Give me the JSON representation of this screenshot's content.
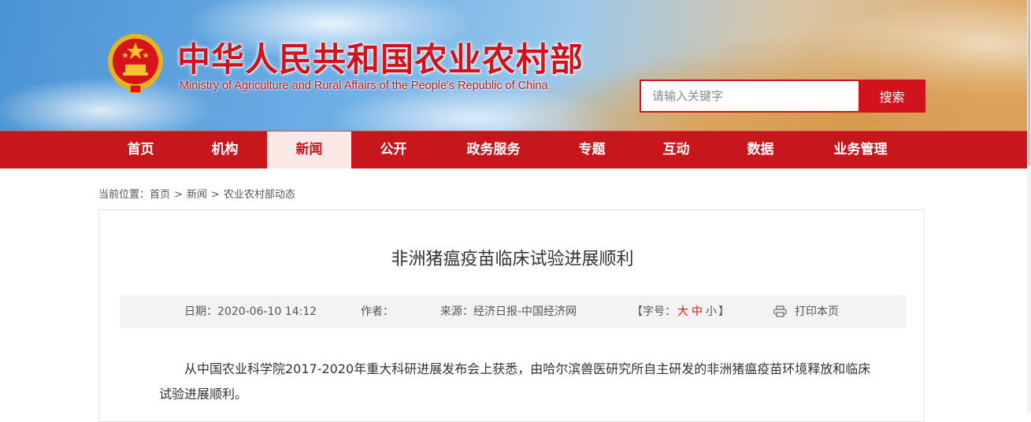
{
  "header": {
    "site_title": "中华人民共和国农业农村部",
    "site_subtitle": "Ministry of Agriculture and Rural Affairs of the People's Republic of China",
    "emblem_icon": "national-emblem-icon",
    "search": {
      "placeholder": "请输入关键字",
      "value": "",
      "button_label": "搜索"
    },
    "colors": {
      "brand_red": "#d0131c",
      "nav_red": "#c8161d",
      "active_tab_bg": "#fde8e8"
    }
  },
  "nav": {
    "items": [
      {
        "label": "首页",
        "active": false
      },
      {
        "label": "机构",
        "active": false
      },
      {
        "label": "新闻",
        "active": true
      },
      {
        "label": "公开",
        "active": false
      },
      {
        "label": "政务服务",
        "active": false
      },
      {
        "label": "专题",
        "active": false
      },
      {
        "label": "互动",
        "active": false
      },
      {
        "label": "数据",
        "active": false
      },
      {
        "label": "业务管理",
        "active": false
      }
    ]
  },
  "breadcrumb": {
    "prefix": "当前位置：",
    "items": [
      "首页",
      "新闻",
      "农业农村部动态"
    ],
    "separator": ">"
  },
  "article": {
    "title": "非洲猪瘟疫苗临床试验进展顺利",
    "meta": {
      "date_label": "日期：",
      "date_value": "2020-06-10 14:12",
      "author_label": "作者：",
      "author_value": "",
      "source_label": "来源：",
      "source_value": "经济日报-中国经济网",
      "fontsize_open": "【字号：",
      "fontsize_large": "大",
      "fontsize_medium": "中",
      "fontsize_small": "小",
      "fontsize_close": "】",
      "print_icon": "printer-icon",
      "print_label": "打印本页"
    },
    "body": "从中国农业科学院2017-2020年重大科研进展发布会上获悉，由哈尔滨兽医研究所自主研发的非洲猪瘟疫苗环境释放和临床试验进展顺利。"
  }
}
